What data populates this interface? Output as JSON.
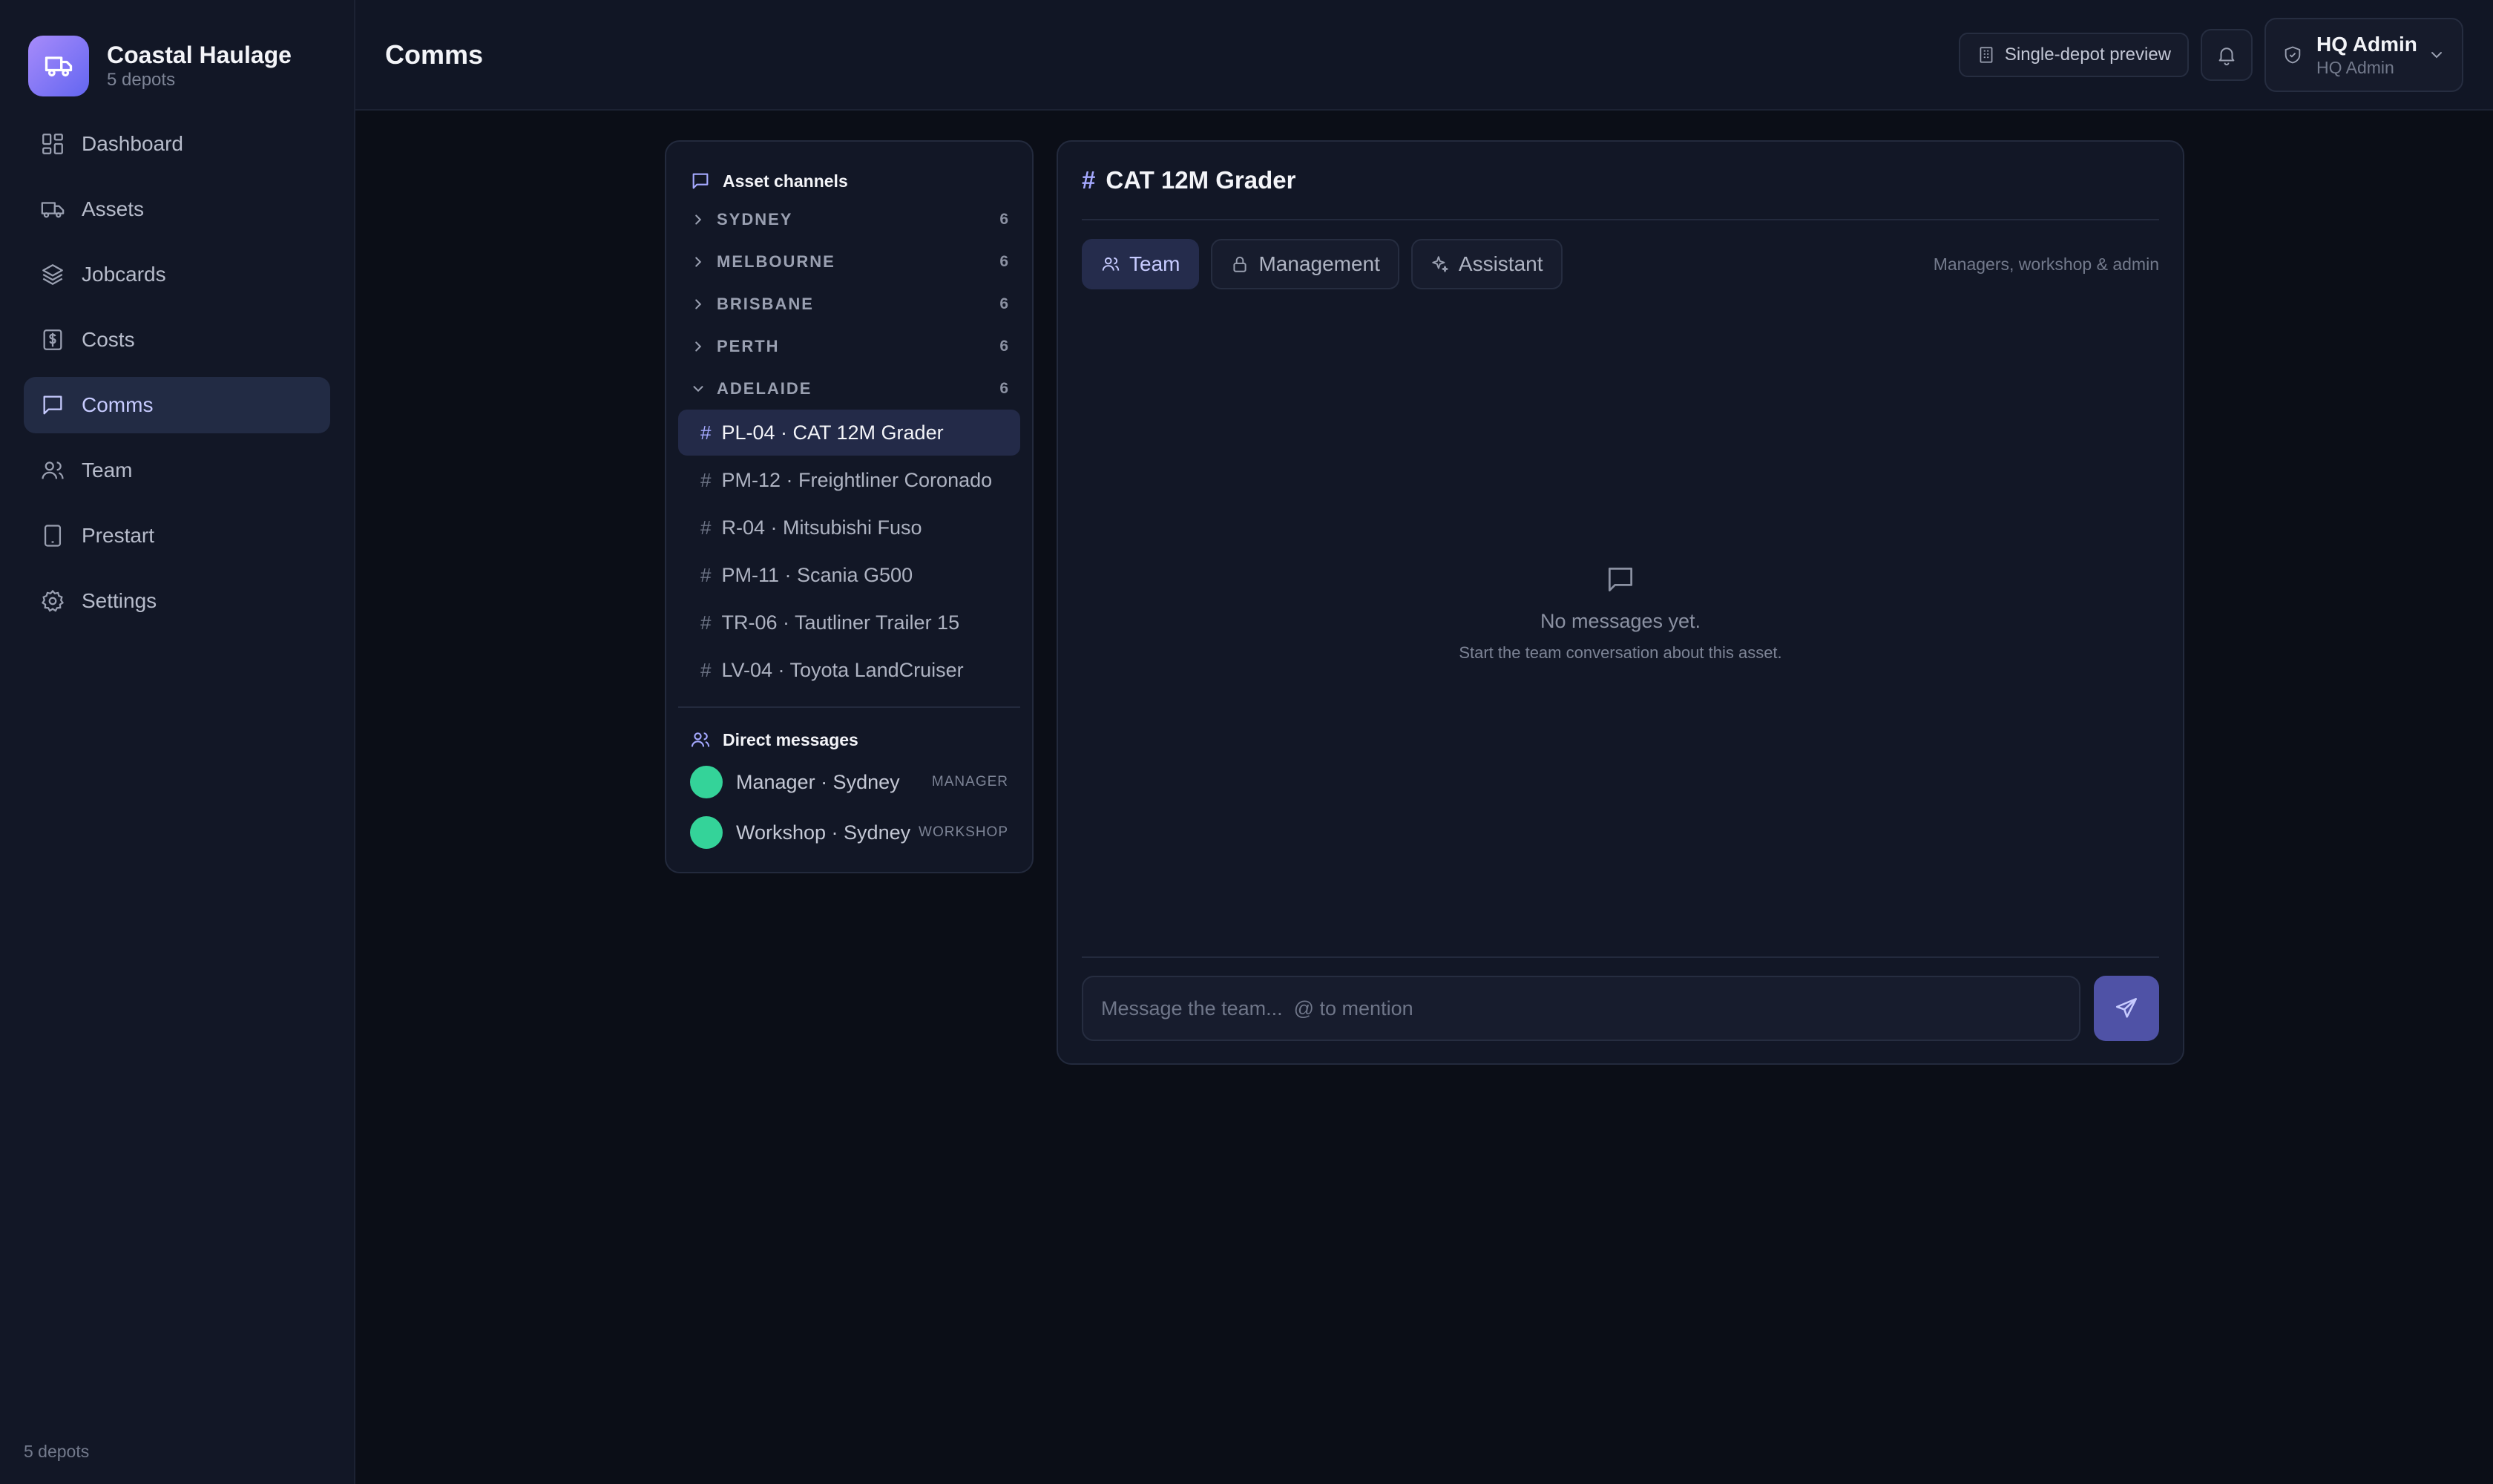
{
  "brand": {
    "name": "Coastal Haulage",
    "subtitle": "5 depots",
    "icon": "truck-icon",
    "accent": "#8b5cf6"
  },
  "sidebar": {
    "items": [
      {
        "label": "Dashboard",
        "icon": "dashboard-icon",
        "active": false
      },
      {
        "label": "Assets",
        "icon": "truck-icon",
        "active": false
      },
      {
        "label": "Jobcards",
        "icon": "layers-icon",
        "active": false
      },
      {
        "label": "Costs",
        "icon": "dollar-icon",
        "active": false
      },
      {
        "label": "Comms",
        "icon": "chat-icon",
        "active": true
      },
      {
        "label": "Team",
        "icon": "users-icon",
        "active": false
      },
      {
        "label": "Prestart",
        "icon": "tablet-icon",
        "active": false
      },
      {
        "label": "Settings",
        "icon": "gear-icon",
        "active": false
      }
    ],
    "footer": "5 depots"
  },
  "header": {
    "title": "Comms",
    "preview_label": "Single-depot preview",
    "user_name": "HQ Admin",
    "user_role": "HQ Admin"
  },
  "channels": {
    "heading": "Asset channels",
    "groups": [
      {
        "name": "SYDNEY",
        "count": "6",
        "expanded": false
      },
      {
        "name": "MELBOURNE",
        "count": "6",
        "expanded": false
      },
      {
        "name": "BRISBANE",
        "count": "6",
        "expanded": false
      },
      {
        "name": "PERTH",
        "count": "6",
        "expanded": false
      },
      {
        "name": "ADELAIDE",
        "count": "6",
        "expanded": true
      }
    ],
    "items": [
      {
        "label": "PL-04 · CAT 12M Grader",
        "active": true
      },
      {
        "label": "PM-12 · Freightliner Coronado",
        "active": false
      },
      {
        "label": "R-04 · Mitsubishi Fuso",
        "active": false
      },
      {
        "label": "PM-11 · Scania G500",
        "active": false
      },
      {
        "label": "TR-06 · Tautliner Trailer 15",
        "active": false
      },
      {
        "label": "LV-04 · Toyota LandCruiser",
        "active": false
      }
    ],
    "dm_heading": "Direct messages",
    "dms": [
      {
        "name": "Manager · Sydney",
        "role": "MANAGER",
        "avatar_color": "#34d399"
      },
      {
        "name": "Workshop · Sydney",
        "role": "WORKSHOP",
        "avatar_color": "#34d399"
      }
    ]
  },
  "chat": {
    "hash": "#",
    "title": "CAT 12M Grader",
    "tabs": [
      {
        "label": "Team",
        "icon": "users-icon",
        "active": true
      },
      {
        "label": "Management",
        "icon": "lock-icon",
        "active": false
      },
      {
        "label": "Assistant",
        "icon": "sparkle-icon",
        "active": false
      }
    ],
    "audience_note": "Managers, workshop & admin",
    "empty_title": "No messages yet.",
    "empty_subtitle": "Start the team conversation about this asset.",
    "composer_placeholder": "Message the team...  @ to mention",
    "composer_value": ""
  }
}
